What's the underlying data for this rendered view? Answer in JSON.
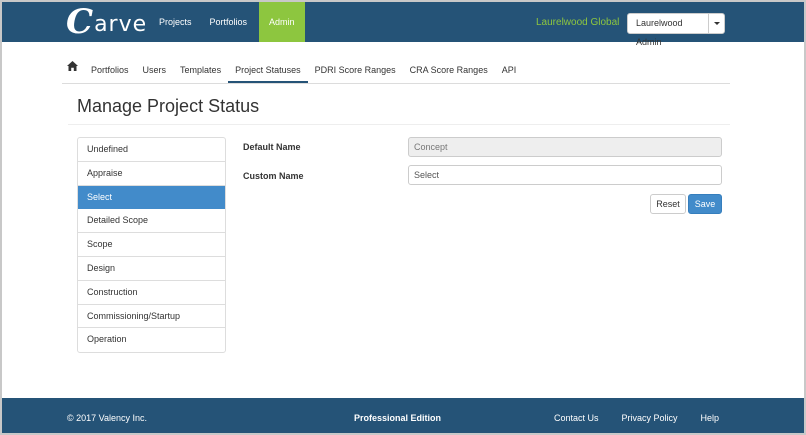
{
  "brand": {
    "logo_initial": "C",
    "logo_rest": "arve"
  },
  "topnav": {
    "items": [
      {
        "label": "Projects"
      },
      {
        "label": "Portfolios"
      },
      {
        "label": "Admin"
      }
    ],
    "active": "Admin"
  },
  "header": {
    "organization": "Laurelwood Global",
    "user_label": "Laurelwood Admin"
  },
  "subnav": {
    "home_icon": "home-icon",
    "tabs": [
      {
        "label": "Portfolios"
      },
      {
        "label": "Users"
      },
      {
        "label": "Templates"
      },
      {
        "label": "Project Statuses"
      },
      {
        "label": "PDRI Score Ranges"
      },
      {
        "label": "CRA Score Ranges"
      },
      {
        "label": "API"
      }
    ],
    "active": "Project Statuses"
  },
  "page": {
    "title": "Manage Project Status"
  },
  "statuses": {
    "items": [
      {
        "label": "Undefined"
      },
      {
        "label": "Appraise"
      },
      {
        "label": "Select"
      },
      {
        "label": "Detailed Scope"
      },
      {
        "label": "Scope"
      },
      {
        "label": "Design"
      },
      {
        "label": "Construction"
      },
      {
        "label": "Commissioning/Startup"
      },
      {
        "label": "Operation"
      }
    ],
    "selected": "Select"
  },
  "form": {
    "default_name_label": "Default Name",
    "default_name_value": "Concept",
    "custom_name_label": "Custom Name",
    "custom_name_value": "Select",
    "reset_label": "Reset",
    "save_label": "Save"
  },
  "footer": {
    "copyright": "© 2017 Valency Inc.",
    "edition": "Professional Edition",
    "links": [
      {
        "label": "Contact Us"
      },
      {
        "label": "Privacy Policy"
      },
      {
        "label": "Help"
      }
    ]
  },
  "colors": {
    "navbar": "#255377",
    "accent_green": "#8dc63f",
    "primary_blue": "#428bca"
  }
}
